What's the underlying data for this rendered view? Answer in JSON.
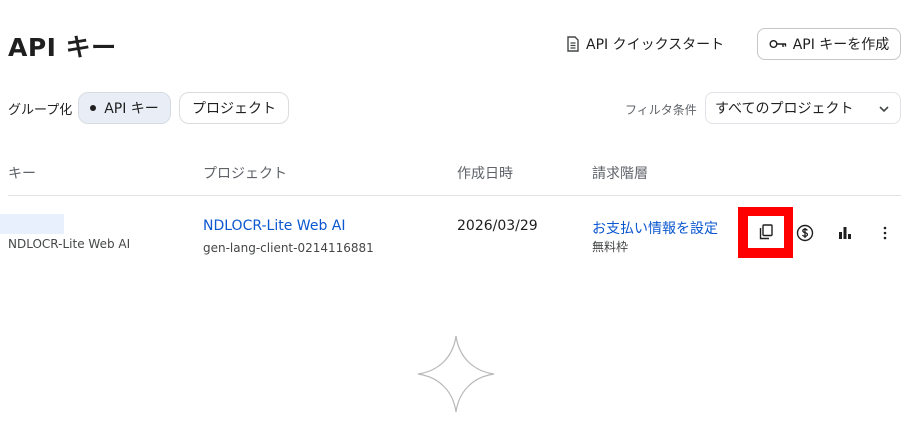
{
  "page": {
    "title": "API キー"
  },
  "header_actions": {
    "quickstart_label": "API クイックスタート",
    "create_key_label": "API キーを作成"
  },
  "grouping": {
    "label": "グループ化",
    "options": [
      "API キー",
      "プロジェクト"
    ],
    "selected": "API キー"
  },
  "filter": {
    "label": "フィルタ条件",
    "value": "すべてのプロジェクト"
  },
  "table": {
    "columns": [
      "キー",
      "プロジェクト",
      "作成日時",
      "請求階層"
    ],
    "rows": [
      {
        "key_name": "NDLOCR-Lite Web AI",
        "project_name": "NDLOCR-Lite Web AI",
        "project_id": "gen-lang-client-0214116881",
        "created": "2026/03/29",
        "billing_link": "お支払い情報を設定",
        "tier": "無料枠"
      }
    ]
  },
  "row_actions": [
    "copy-icon",
    "billing-icon",
    "usage-chart-icon",
    "more-vert-icon"
  ],
  "colors": {
    "accent": "#0b57d0",
    "highlight": "#ff0000",
    "chip_bg": "#e9eef6"
  }
}
